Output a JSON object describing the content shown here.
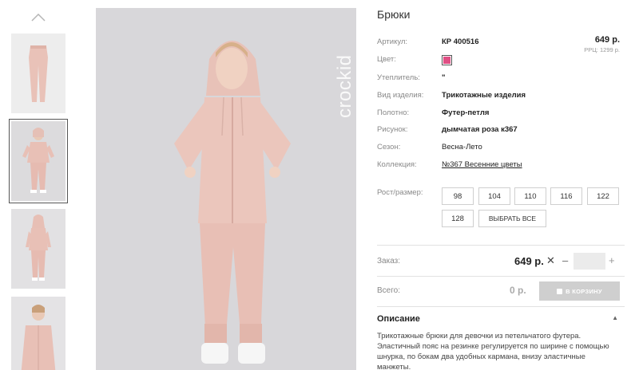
{
  "gallery": {
    "up_icon": "chevron-up-icon",
    "brand_watermark": "crockid"
  },
  "product": {
    "title": "Брюки",
    "price": "649 р.",
    "rrp": "РРЦ: 1299 р.",
    "color_hex": "#e04f84",
    "attributes": [
      {
        "label": "Артикул:",
        "value": "КР 400516"
      },
      {
        "label": "Цвет:",
        "value": ""
      },
      {
        "label": "Утеплитель:",
        "value": "\""
      },
      {
        "label": "Вид изделия:",
        "value": "Трикотажные изделия"
      },
      {
        "label": "Полотно:",
        "value": "Футер-петля"
      },
      {
        "label": "Рисунок:",
        "value": "дымчатая роза к367"
      },
      {
        "label": "Сезон:",
        "value": "Весна-Лето"
      },
      {
        "label": "Коллекция:",
        "value": "№367 Весенние цветы"
      }
    ],
    "sizes_label": "Рост/размер:",
    "sizes": [
      "98",
      "104",
      "110",
      "116",
      "122",
      "128"
    ],
    "select_all_label": "ВЫБРАТЬ ВСЕ"
  },
  "order": {
    "label": "Заказ:",
    "price": "649 р.",
    "remove_symbol": "✕",
    "minus": "–",
    "plus": "+",
    "quantity": ""
  },
  "total": {
    "label": "Всего:",
    "value": "0 р.",
    "cart_label": "В КОРЗИНУ"
  },
  "description": {
    "heading": "Описание",
    "toggle": "▲",
    "text": "Трикотажные брюки для девочки из петельчатого футера. Эластичный пояс на резинке регулируется по ширине с помощью шнурка, по бокам два удобных кармана, внизу эластичные манжеты."
  }
}
